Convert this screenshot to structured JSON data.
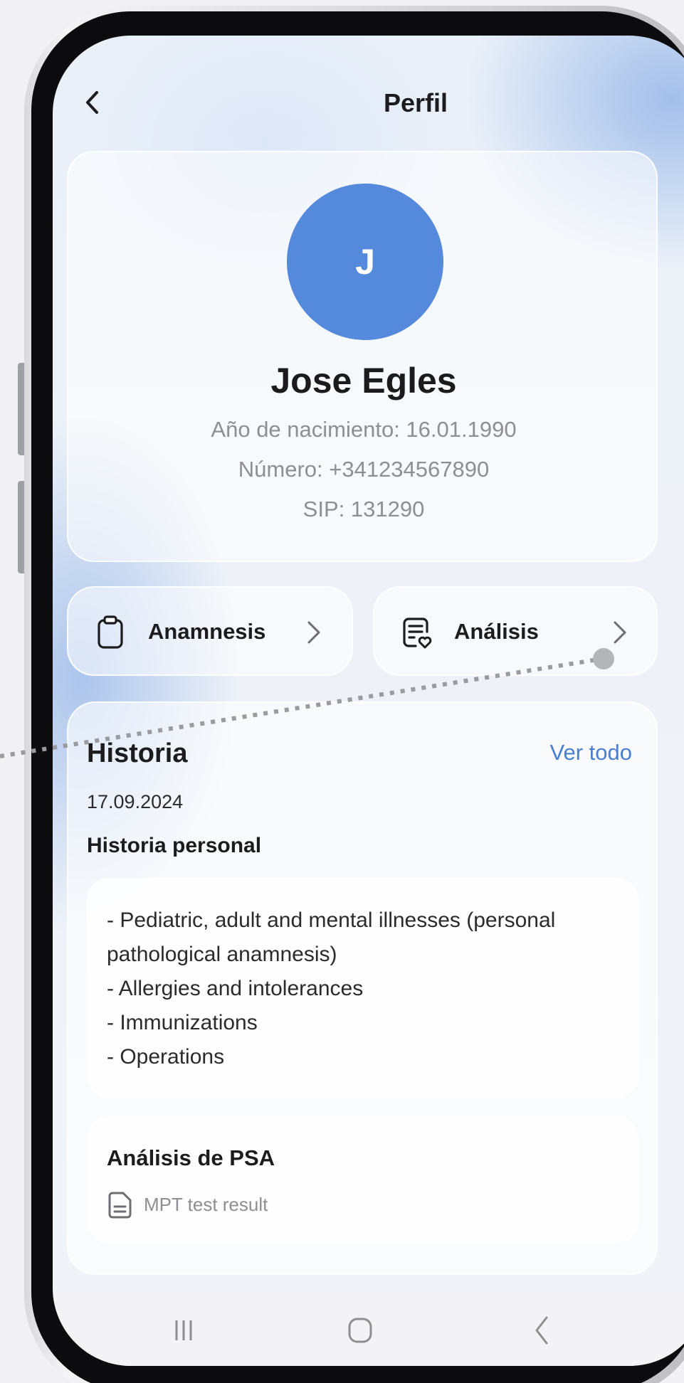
{
  "header": {
    "title": "Perfil",
    "back_icon": "chevron-left-icon"
  },
  "profile": {
    "avatar_initial": "J",
    "avatar_color": "#5489dc",
    "name": "Jose Egles",
    "birth": "Año de nacimiento: 16.01.1990",
    "phone": "Número: +341234567890",
    "sip": "SIP: 131290"
  },
  "actions": {
    "anamnesis": {
      "label": "Anamnesis",
      "icon": "clipboard-icon"
    },
    "analysis": {
      "label": "Análisis",
      "icon": "medical-report-icon"
    }
  },
  "history": {
    "title": "Historia",
    "see_all": "Ver todo",
    "date": "17.09.2024",
    "subtitle": "Historia personal",
    "notes": [
      "- Pediatric, adult and mental illnesses (personal",
      "pathological anamnesis)",
      "- Allergies and intolerances",
      "- Immunizations",
      "- Operations"
    ],
    "psa": {
      "title": "Análisis de PSA",
      "subtitle": "MPT test result",
      "icon": "document-icon"
    }
  },
  "navbar": {
    "recents_icon": "recents-icon",
    "home_icon": "home-icon",
    "back_icon": "back-icon"
  },
  "colors": {
    "accent": "#4a7fd0",
    "avatar": "#5489dc",
    "text": "#1c1c1e",
    "muted": "#8e8e93"
  }
}
